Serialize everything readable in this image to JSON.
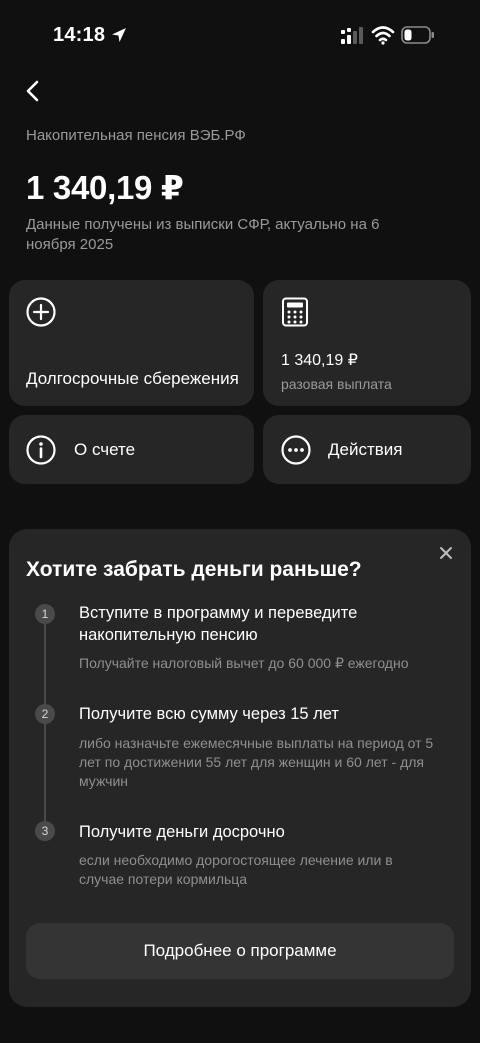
{
  "status_bar": {
    "time": "14:18"
  },
  "header": {
    "product_name": "Накопительная пенсия ВЭБ.РФ",
    "balance": "1 340,19 ₽",
    "data_note": "Данные получены из выписки СФР, актуально на 6 ноября 2025"
  },
  "tiles": {
    "savings_label": "Долгосрочные сбережения",
    "payout_amount": "1 340,19 ₽",
    "payout_label": "разовая выплата",
    "about_label": "О счете",
    "actions_label": "Действия"
  },
  "promo": {
    "title": "Хотите забрать деньги раньше?",
    "steps": [
      {
        "num": "1",
        "title": "Вступите в программу и переведите накопительную пенсию",
        "desc": "Получайте налоговый вычет до 60 000 ₽ ежегодно"
      },
      {
        "num": "2",
        "title": "Получите всю сумму через 15 лет",
        "desc": "либо назначьте ежемесячные выплаты на период от 5 лет по достижении 55 лет для женщин и 60 лет - для мужчин"
      },
      {
        "num": "3",
        "title": "Получите деньги досрочно",
        "desc": "если необходимо дорогостоящее лечение или в случае потери кормильца"
      }
    ],
    "button_label": "Подробнее о программе"
  }
}
